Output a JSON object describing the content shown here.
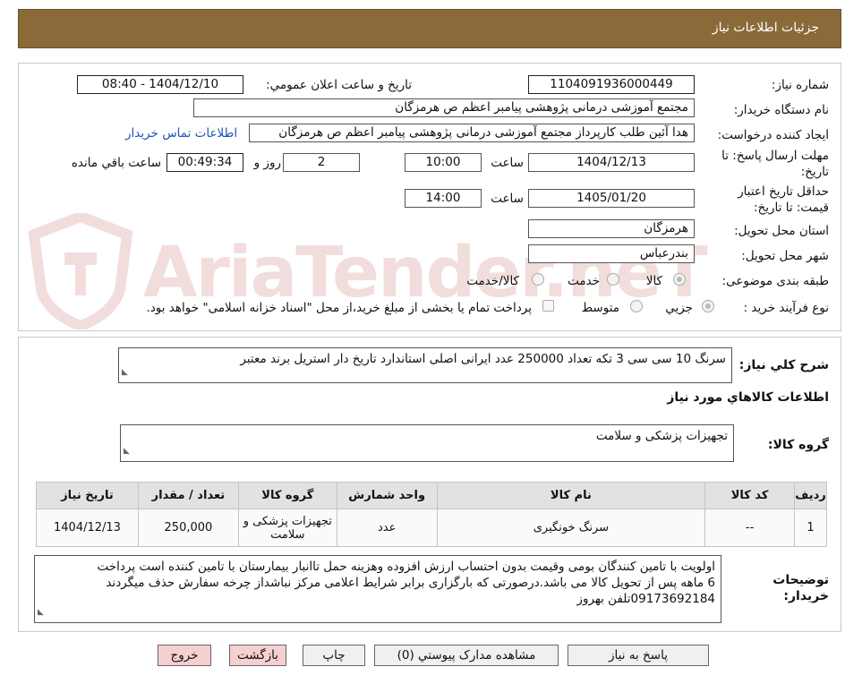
{
  "header": {
    "title": "جزئیات اطلاعات نیاز"
  },
  "form": {
    "need_number_label": "شماره نیاز:",
    "need_number": "1104091936000449",
    "announce_label": "تاریخ و ساعت اعلان عمومي:",
    "announce_value": "1404/12/10 - 08:40",
    "buyer_org_label": "نام دستگاه خریدار:",
    "buyer_org": "مجتمع آموزشی درمانی پژوهشی پیامبر اعظم ص  هرمزگان",
    "requester_label": "ایجاد کننده درخواست:",
    "requester": "هدا آئین طلب کارپرداز مجتمع آموزشی درمانی پژوهشی پیامبر اعظم ص  هرمزگان",
    "contact_link": "اطلاعات تماس خریدار",
    "deadline_label_1": "مهلت ارسال پاسخ: تا",
    "deadline_label_2": "تاریخ:",
    "deadline_date": "1404/12/13",
    "time_label": "ساعت",
    "deadline_time": "10:00",
    "days_value": "2",
    "days_label": "روز و",
    "remaining_time": "00:49:34",
    "remaining_label": "ساعت باقي مانده",
    "validity_label_1": "حداقل تاریخ اعتبار",
    "validity_label_2": "قیمت: تا تاریخ:",
    "validity_date": "1405/01/20",
    "validity_time_label": "ساعت",
    "validity_time": "14:00",
    "province_label": "استان محل تحویل:",
    "province": "هرمزگان",
    "city_label": "شهر محل تحویل:",
    "city": "بندرعباس",
    "category_label": "طبقه بندی موضوعی:",
    "category_options": [
      "کالا",
      "خدمت",
      "کالا/خدمت"
    ],
    "process_label": "نوع فرآیند خرید :",
    "process_options": [
      "جزیي",
      "متوسط"
    ],
    "payment_note": "پرداخت تمام یا بخشی از مبلغ خرید،از محل \"اسناد خزانه اسلامی\" خواهد بود."
  },
  "watermark": {
    "text": "AriaTender.neT"
  },
  "details": {
    "summary_label": "شرح کلي نیاز:",
    "summary": "سرنگ 10 سی سی 3 تکه تعداد 250000  عدد ایرانی اصلی استاندارد تاریخ دار استریل برند معتبر",
    "goods_info_title": "اطلاعات کالاهاي مورد نیاز",
    "goods_group_label": "گروه کالا:",
    "goods_group": "تجهیزات پزشکی و سلامت",
    "table": {
      "headers": [
        "ردیف",
        "کد کالا",
        "نام کالا",
        "واحد شمارش",
        "گروه کالا",
        "تعداد / مقدار",
        "تاریخ نیاز"
      ],
      "rows": [
        [
          "1",
          "--",
          "سرنگ خونگیری",
          "عدد",
          "تجهیزات پزشکی و سلامت",
          "250,000",
          "1404/12/13"
        ]
      ]
    },
    "buyer_notes_label_1": "توضیحات",
    "buyer_notes_label_2": "خریدار:",
    "buyer_notes": [
      "اولویت با تامین کنندگان بومی وقیمت بدون احتساب ارزش افزوده وهزینه حمل تاانبار بیمارستان با تامین کننده است پرداخت",
      "6 ماهه پس از تحویل کالا می باشد.درصورتی که بارگزاری برابر شرایط اعلامی مرکز نباشداز چرخه سفارش حذف میگردند",
      "09173692184تلفن بهروز"
    ]
  },
  "buttons": {
    "reply": "پاسخ به نیاز",
    "attachments": "مشاهده مدارک پیوستي (0)",
    "print": "چاپ",
    "back": "بازگشت",
    "exit": "خروج"
  }
}
